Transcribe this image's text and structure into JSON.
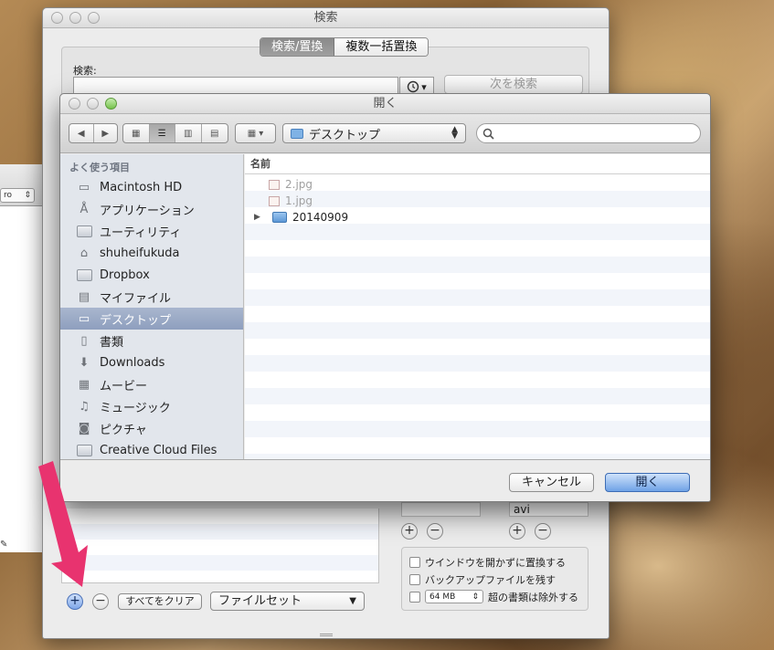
{
  "side_window": {
    "select_value": "ro"
  },
  "search_window": {
    "title": "検索",
    "tabs": [
      "検索/置換",
      "複数一括置換"
    ],
    "search_label": "検索:",
    "search_value": "",
    "next_button": "次を検索",
    "extension_value": "avi",
    "options": {
      "no_open_window": "ウインドウを開かずに置換する",
      "keep_backup": "バックアップファイルを残す",
      "size_value": "64 MB",
      "exclude_over": "超の書類は除外する"
    },
    "clear_all_button": "すべてをクリア",
    "fileset_popup": "ファイルセット",
    "add_symbol": "+",
    "remove_symbol": "−"
  },
  "open_dialog": {
    "title": "開く",
    "location": "デスクトップ",
    "search_placeholder": "",
    "sidebar_header": "よく使う項目",
    "sidebar_items": [
      {
        "label": "Macintosh HD",
        "icon": "hard-disk-icon"
      },
      {
        "label": "アプリケーション",
        "icon": "applications-icon"
      },
      {
        "label": "ユーティリティ",
        "icon": "folder-icon"
      },
      {
        "label": "shuheifukuda",
        "icon": "home-icon"
      },
      {
        "label": "Dropbox",
        "icon": "folder-icon"
      },
      {
        "label": "マイファイル",
        "icon": "all-my-files-icon"
      },
      {
        "label": "デスクトップ",
        "icon": "desktop-icon",
        "selected": true
      },
      {
        "label": "書類",
        "icon": "documents-icon"
      },
      {
        "label": "Downloads",
        "icon": "downloads-icon"
      },
      {
        "label": "ムービー",
        "icon": "movies-icon"
      },
      {
        "label": "ミュージック",
        "icon": "music-icon"
      },
      {
        "label": "ピクチャ",
        "icon": "pictures-icon"
      },
      {
        "label": "Creative Cloud Files",
        "icon": "folder-icon"
      }
    ],
    "column_header": "名前",
    "files": [
      {
        "name": "2.jpg",
        "type": "image",
        "dimmed": true
      },
      {
        "name": "1.jpg",
        "type": "image",
        "dimmed": true
      },
      {
        "name": "20140909",
        "type": "folder",
        "dimmed": false
      }
    ],
    "cancel_button": "キャンセル",
    "open_button": "開く"
  },
  "colors": {
    "annotation_arrow": "#e8336f",
    "default_button": "#6fa2e6",
    "sidebar_selected": "#8e9fbe"
  }
}
